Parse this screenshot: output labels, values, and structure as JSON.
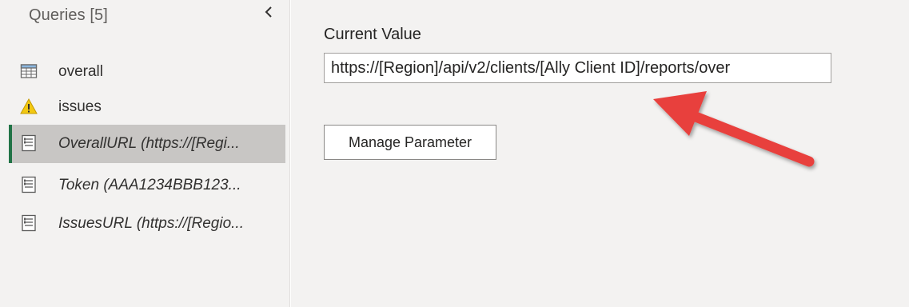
{
  "queries_pane": {
    "title": "Queries [5]",
    "collapse_icon": "chevron-left-icon",
    "items": [
      {
        "label": "overall",
        "icon": "table-icon",
        "italic": false,
        "selected": false
      },
      {
        "label": "issues",
        "icon": "warning-icon",
        "italic": false,
        "selected": false
      },
      {
        "label": "OverallURL (https://[Regi...",
        "icon": "parameter-icon",
        "italic": true,
        "selected": true
      },
      {
        "label": "Token (AAA1234BBB123...",
        "icon": "parameter-icon",
        "italic": true,
        "selected": false
      },
      {
        "label": "IssuesURL (https://[Regio...",
        "icon": "parameter-icon",
        "italic": true,
        "selected": false
      }
    ]
  },
  "parameter": {
    "current_value_label": "Current Value",
    "current_value": "https://[Region]/api/v2/clients/[Ally Client ID]/reports/over",
    "manage_button_label": "Manage Parameter"
  },
  "colors": {
    "selected_accent": "#217346",
    "annotation_arrow": "#e8403d",
    "warning": "#f2c811"
  }
}
